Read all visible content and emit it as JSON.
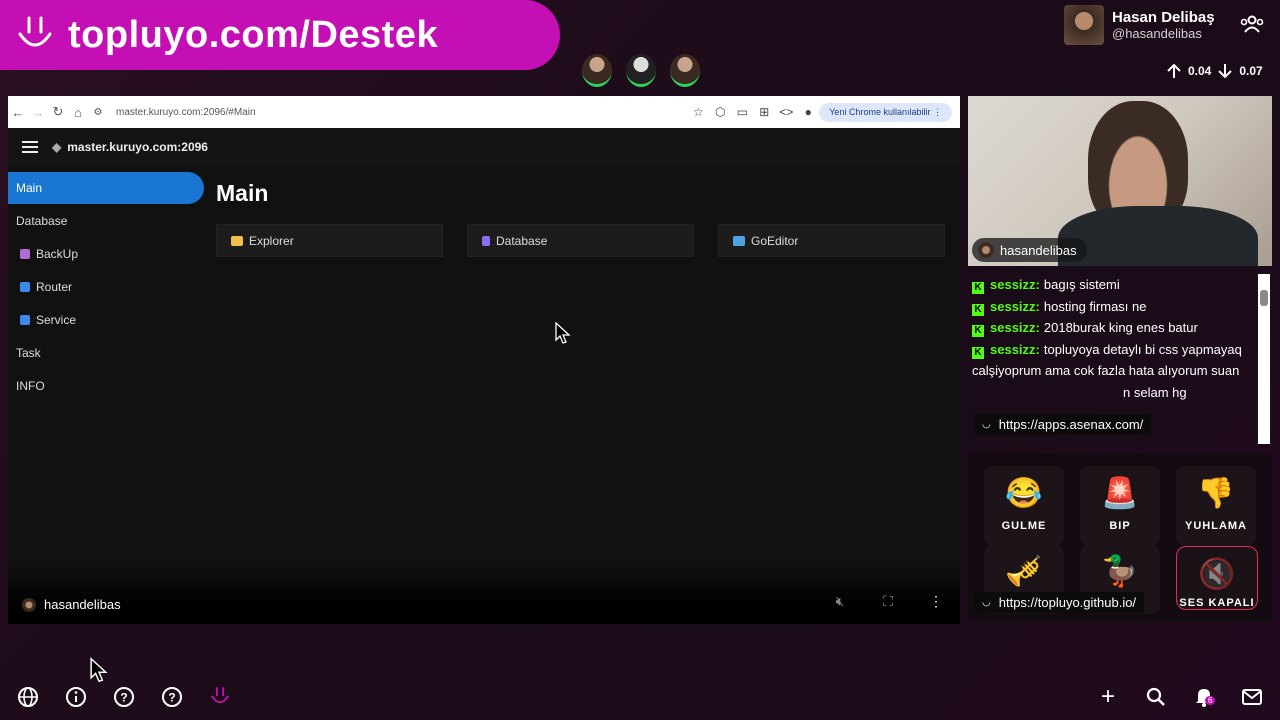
{
  "banner": {
    "text": "topluyo.com/Destek"
  },
  "user": {
    "name": "Hasan Delibaş",
    "handle": "@hasandelibas"
  },
  "speed": {
    "up": "0.04",
    "down": "0.07"
  },
  "browser": {
    "url": "master.kuruyo.com:2096/#Main",
    "chrome_badge": "Yeni Chrome kullanılabilir"
  },
  "app": {
    "host": "master.kuruyo.com:2096",
    "title": "Main",
    "sidebar": [
      {
        "label": "Main",
        "active": true
      },
      {
        "label": "Database"
      },
      {
        "label": "BackUp",
        "icon_color": "#b36bd6"
      },
      {
        "label": "Router",
        "icon_color": "#3d8be8"
      },
      {
        "label": "Service",
        "icon_color": "#3d8be8"
      },
      {
        "label": "Task"
      },
      {
        "label": "INFO"
      }
    ],
    "cards": [
      {
        "label": "Explorer",
        "icon_color": "#f0c24b"
      },
      {
        "label": "Database",
        "icon_color": "#8a6df0"
      },
      {
        "label": "GoEditor",
        "icon_color": "#4fa3e0"
      }
    ]
  },
  "stream": {
    "username": "hasandelibas"
  },
  "cam": {
    "username": "hasandelibas"
  },
  "chat": [
    {
      "user": "sessizz:",
      "msg": "bagış sistemi"
    },
    {
      "user": "sessizz:",
      "msg": "hosting firması ne"
    },
    {
      "user": "sessizz:",
      "msg": "2018burak king enes batur"
    },
    {
      "user": "sessizz:",
      "msg": "topluyoya detaylı bi css yapmayaq calşiyoprum ama cok fazla hata alıyorum suan"
    }
  ],
  "chat_partial": "n selam hg",
  "links": {
    "asenax": "https://apps.asenax.com/",
    "github": "https://topluyo.github.io/"
  },
  "sounds": [
    {
      "emoji": "😂",
      "label": "GULME"
    },
    {
      "emoji": "🚨",
      "label": "BIP"
    },
    {
      "emoji": "👎",
      "label": "YUHLAMA"
    },
    {
      "emoji": "🎺",
      "label": ""
    },
    {
      "emoji": "🦆",
      "label": ""
    },
    {
      "emoji": "🔇",
      "label": "SES KAPALI"
    }
  ],
  "notifications": {
    "count": "6"
  },
  "colors": {
    "brand": "#c40fb4",
    "accent": "#1976d2",
    "kick_green": "#53fc18"
  }
}
